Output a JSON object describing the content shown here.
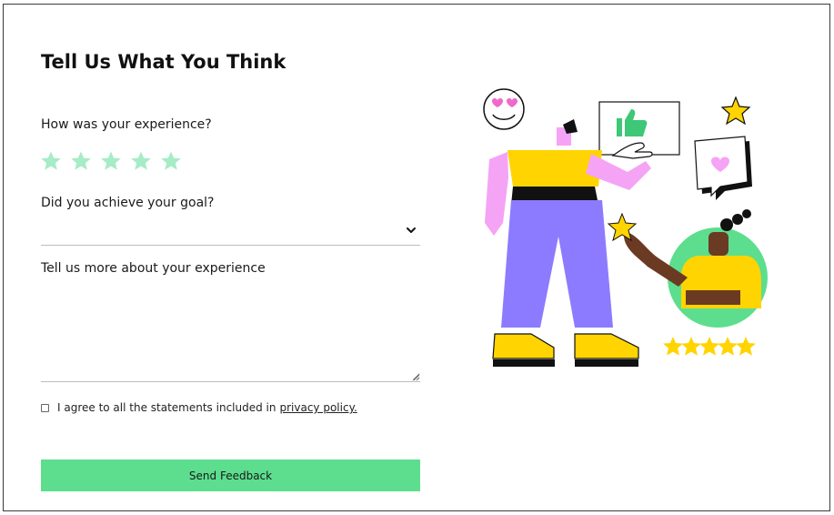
{
  "form": {
    "title": "Tell Us What You Think",
    "rating": {
      "label": "How was your experience?",
      "max": 5,
      "value": 0,
      "star_color": "#a6ecc6"
    },
    "goal": {
      "label": "Did you achieve your goal?",
      "value": ""
    },
    "details": {
      "label": "Tell us more about your experience",
      "value": ""
    },
    "agreement": {
      "text": "I agree to all the statements included in",
      "link_text": "privacy policy.",
      "checked": false
    },
    "submit": {
      "label": "Send Feedback",
      "color": "#5cde8e"
    }
  },
  "illustration": {
    "icons": [
      "heart-eyes-emoji-icon",
      "thumbs-up-icon",
      "heart-speech-bubble-icon",
      "star-icon",
      "five-star-rating-icon"
    ],
    "colors": {
      "yellow": "#ffd400",
      "purple": "#8c7bff",
      "pink": "#f5a3f5",
      "green": "#5cde8e",
      "skin_dark": "#6b3a22"
    }
  }
}
